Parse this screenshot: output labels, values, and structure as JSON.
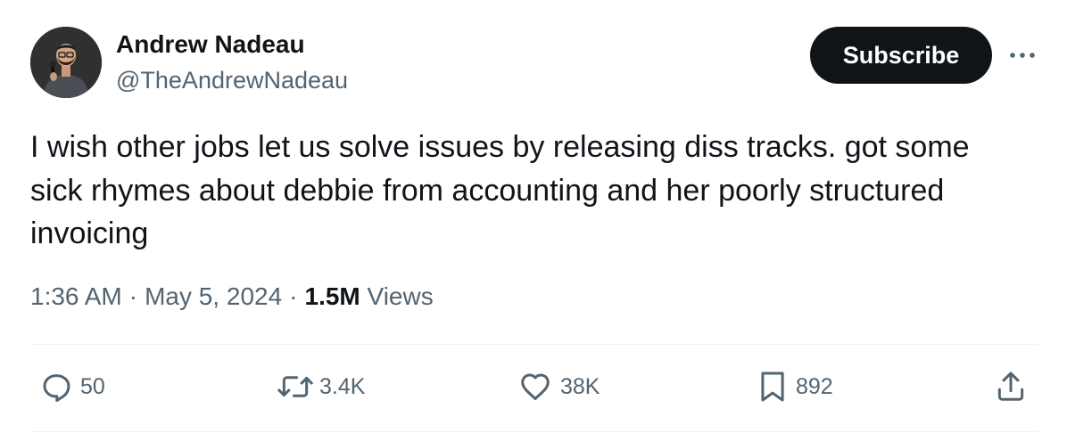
{
  "author": {
    "name": "Andrew Nadeau",
    "handle": "@TheAndrewNadeau",
    "avatar_icon": "user-avatar-photo"
  },
  "header": {
    "subscribe_label": "Subscribe",
    "more_icon": "more-horizontal-icon"
  },
  "tweet": {
    "text": "I wish other jobs let us solve issues by releasing diss tracks. got some\nsick rhymes about debbie from accounting and her poorly structured\ninvoicing"
  },
  "meta": {
    "time": "1:36 AM",
    "separator": "·",
    "date": "May 5, 2024",
    "views_count": "1.5M",
    "views_label": "Views"
  },
  "actions": [
    {
      "name": "reply",
      "icon": "reply-icon",
      "count": "50"
    },
    {
      "name": "retweet",
      "icon": "retweet-icon",
      "count": "3.4K"
    },
    {
      "name": "like",
      "icon": "heart-icon",
      "count": "38K"
    },
    {
      "name": "bookmark",
      "icon": "bookmark-icon",
      "count": "892"
    },
    {
      "name": "share",
      "icon": "share-icon",
      "count": ""
    }
  ],
  "colors": {
    "text_primary": "#0f1419",
    "text_secondary": "#536471",
    "button_bg": "#0f1419",
    "button_text": "#ffffff",
    "divider": "#eff3f4"
  }
}
